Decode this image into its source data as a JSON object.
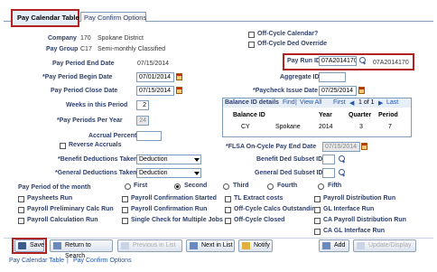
{
  "tabs": [
    {
      "label": "Pay Calendar Table",
      "active": true
    },
    {
      "label": "Pay Confirm Options",
      "active": false
    }
  ],
  "header": {
    "company_label": "Company",
    "company_code": "170",
    "company_name": "Spokane District",
    "paygroup_label": "Pay Group",
    "paygroup_code": "C17",
    "paygroup_name": "Semi-monthly Classified"
  },
  "dates": {
    "end_label": "Pay Period End Date",
    "end_value": "07/15/2014",
    "begin_label": "*Pay Period Begin Date",
    "begin_value": "07/01/2014",
    "close_label": "Pay Period Close Date",
    "close_value": "07/15/2014",
    "weeks_label": "Weeks in this Period",
    "weeks_value": "2",
    "periods_label": "*Pay Periods Per Year",
    "periods_value": "24",
    "accrual_label": "Accrual Percent",
    "accrual_value": "",
    "reverse_label": "Reverse Accruals"
  },
  "right": {
    "offcycle_cal": "Off-Cycle Calendar?",
    "offcycle_ded": "Off-Cycle Ded Override",
    "payrun_label": "Pay Run ID",
    "payrun_value": "07A2014170",
    "payrun_display": "07A2014170",
    "aggregate_label": "Aggregate ID",
    "aggregate_value": "",
    "paycheck_label": "*Paycheck Issue Date",
    "paycheck_value": "07/25/2014"
  },
  "balance": {
    "title": "Balance ID details",
    "find": "Find",
    "view_all": "View All",
    "pager": "1 of 1",
    "first": "First",
    "last": "Last",
    "columns": [
      "Balance ID",
      "Year",
      "Quarter",
      "Period"
    ],
    "row": [
      "CY",
      "Spokane",
      "2014",
      "3",
      "7"
    ]
  },
  "flsa": {
    "label": "*FLSA On-Cycle Pay End Date",
    "value": "07/15/2014"
  },
  "deductions": {
    "benefit_label": "*Benefit Deductions Taken",
    "benefit_value": "Deduction",
    "general_label": "*General Deductions Taken",
    "general_value": "Deduction",
    "benefit_subset_label": "Benefit Ded Subset ID",
    "general_subset_label": "General Ded Subset ID"
  },
  "period": {
    "label": "Pay Period of the month",
    "options": [
      "First",
      "Second",
      "Third",
      "Fourth",
      "Fifth"
    ],
    "selected": "Second"
  },
  "checks": {
    "col1": [
      "Paysheets Run",
      "Payroll Preliminary Calc Run",
      "Payroll Calculation Run"
    ],
    "col2": [
      "Payroll Confirmation Started",
      "Payroll Confirmation Run",
      "Single Check for Multiple Jobs"
    ],
    "col3": [
      "TL Extract costs",
      "Off-Cycle Calcs Outstanding",
      "Off-Cycle Closed"
    ],
    "col4": [
      "Payroll Distribution Run",
      "GL Interface Run",
      "CA Payroll Distribution Run",
      "CA GL Interface Run"
    ]
  },
  "toolbar": {
    "save": "Save",
    "return": "Return to Search",
    "prev": "Previous in List",
    "next": "Next in List",
    "notify": "Notify",
    "add": "Add",
    "update": "Update/Display"
  },
  "footer": {
    "link1": "Pay Calendar Table",
    "sep": " | ",
    "link2": "Pay Confirm Options"
  },
  "colors": {
    "highlight": "#b22222",
    "label": "#2c3e6a",
    "link": "#2255aa",
    "section": "#e6eef8"
  }
}
